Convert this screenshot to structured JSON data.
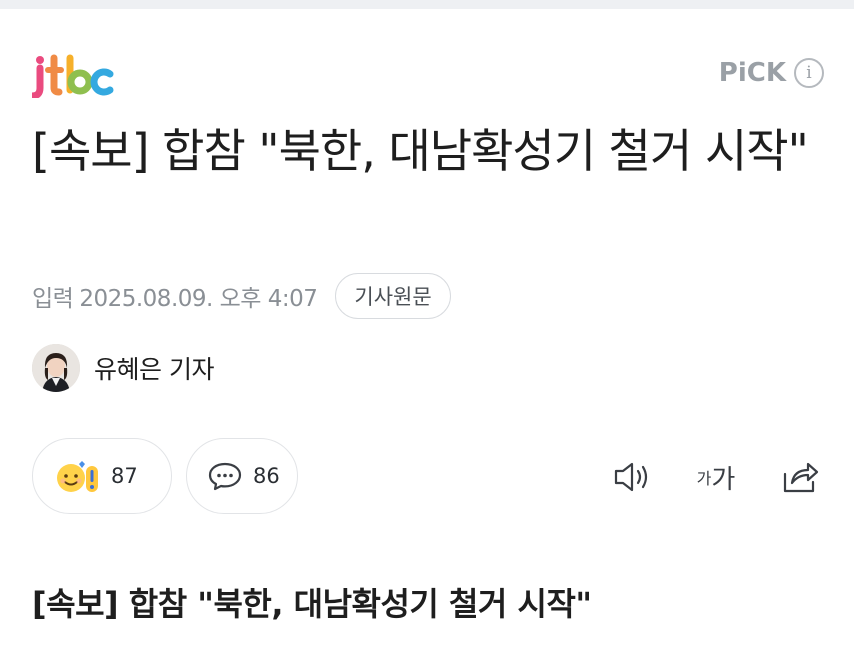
{
  "header": {
    "logo_text": "JTBC",
    "pick_label": "PiCK",
    "info_icon": "info-icon"
  },
  "article": {
    "headline": "[속보] 합참 \"북한, 대남확성기 철거 시작\"",
    "meta_label": "입력",
    "date": "2025.08.09. 오후 4:07",
    "original_button": "기사원문",
    "author": "유혜은 기자",
    "reactions_count": "87",
    "comments_count": "86",
    "subheadline": "[속보] 합참 \"북한, 대남확성기 철거 시작\""
  },
  "tools": {
    "font_small": "가",
    "font_big": "가"
  },
  "colors": {
    "logo_pink": "#e8407a",
    "logo_orange": "#f6a623",
    "logo_blue": "#37a7de",
    "muted": "#8a8f95",
    "text": "#1e1e1e"
  }
}
